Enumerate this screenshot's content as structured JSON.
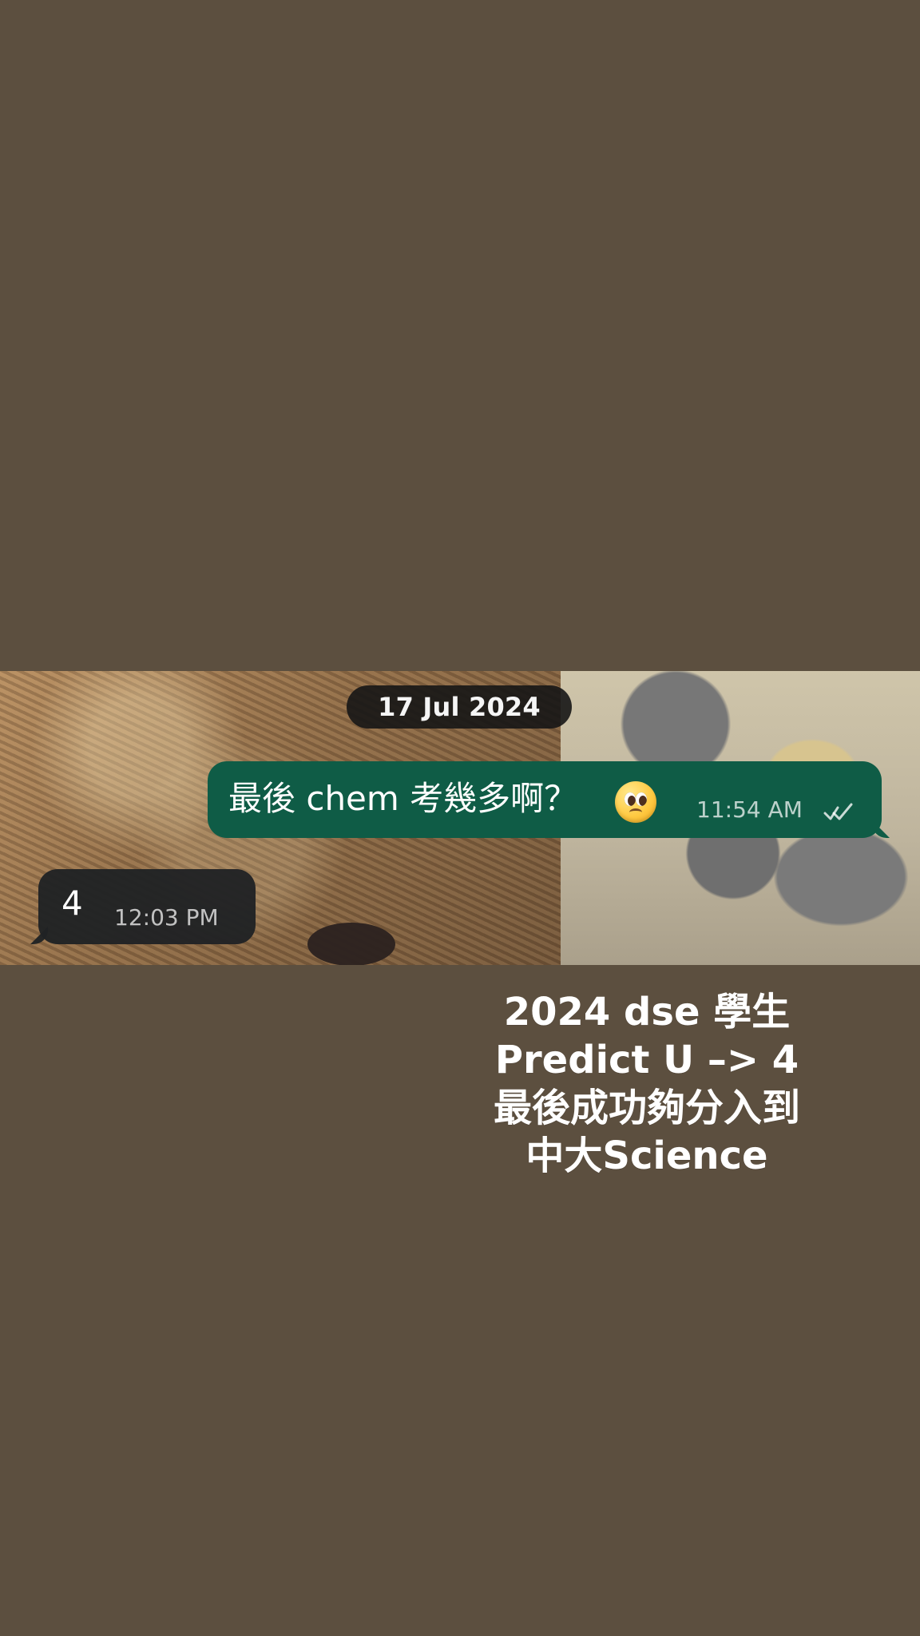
{
  "chat": {
    "date_label": "17 Jul 2024",
    "messages": [
      {
        "direction": "outgoing",
        "text": "最後 chem 考幾多啊？",
        "emoji": "pleading-face-emoji",
        "time": "11:54 AM",
        "status_icon": "double-check-icon"
      },
      {
        "direction": "incoming",
        "text": "4",
        "time": "12:03 PM"
      }
    ]
  },
  "caption": {
    "lines": [
      "2024 dse 學生",
      "Predict U –> 4",
      "最後成功夠分入到",
      "中大Science"
    ]
  },
  "colors": {
    "page_background": "#5c4f3f",
    "outgoing_bubble": "#0f5c46",
    "incoming_bubble": "#202224",
    "text": "#ffffff"
  }
}
